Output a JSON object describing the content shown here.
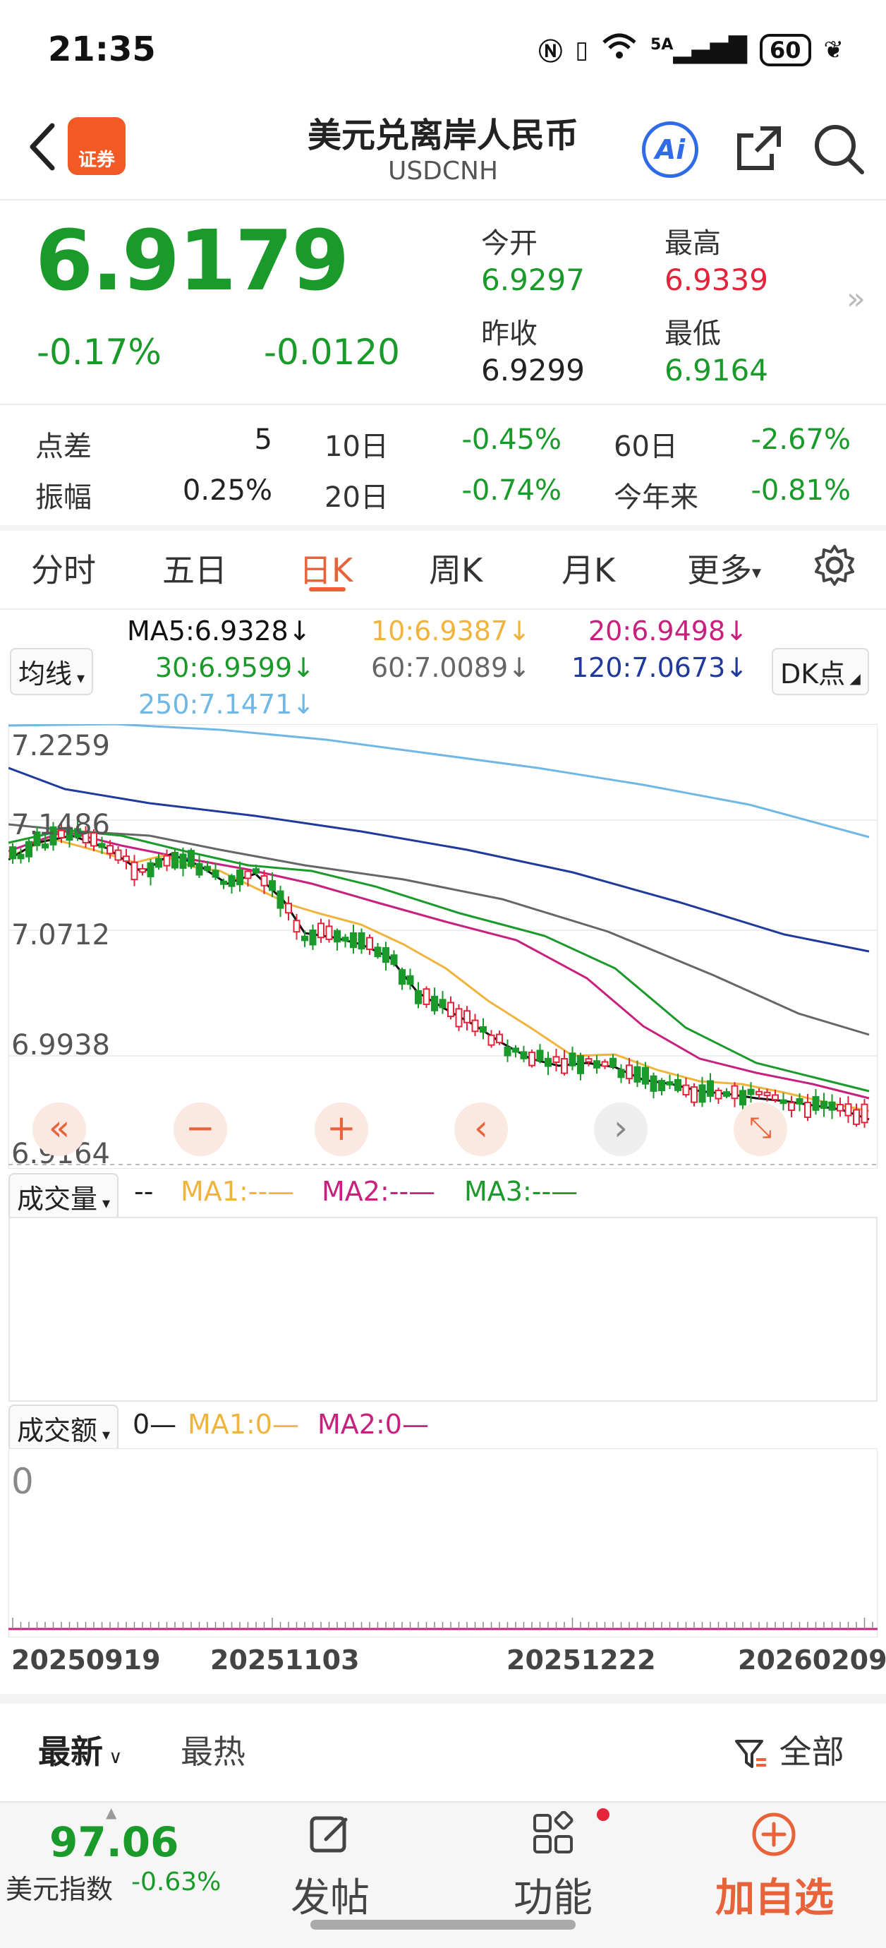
{
  "status_bar": {
    "time": "21:35",
    "signal": "5A",
    "battery": "60"
  },
  "header": {
    "app_logo_text": "证券",
    "title": "美元兑离岸人民币",
    "subtitle": "USDCNH",
    "ai_label": "Ai"
  },
  "quote": {
    "price": "6.9179",
    "change_pct": "-0.17%",
    "change_abs": "-0.0120",
    "open_label": "今开",
    "open": "6.9297",
    "high_label": "最高",
    "high": "6.9339",
    "prev_close_label": "昨收",
    "prev_close": "6.9299",
    "low_label": "最低",
    "low": "6.9164",
    "more_arrow": "»"
  },
  "stats": {
    "spread_label": "点差",
    "spread": "5",
    "d10_label": "10日",
    "d10": "-0.45%",
    "d60_label": "60日",
    "d60": "-2.67%",
    "amplitude_label": "振幅",
    "amplitude": "0.25%",
    "d20_label": "20日",
    "d20": "-0.74%",
    "ytd_label": "今年来",
    "ytd": "-0.81%"
  },
  "tabs": [
    "分时",
    "五日",
    "日K",
    "周K",
    "月K",
    "更多"
  ],
  "ma_legend": {
    "selector": "均线",
    "ma5": "MA5:6.9328↓",
    "ma10": "10:6.9387↓",
    "ma20": "20:6.9498↓",
    "ma30": "30:6.9599↓",
    "ma60": "60:7.0089↓",
    "ma120": "120:7.0673↓",
    "ma250": "250:7.1471↓",
    "dk": "DK点"
  },
  "colors": {
    "up": "#e3243b",
    "down": "#1a9a2a",
    "ma5": "#111111",
    "ma10": "#f0b43c",
    "ma20": "#c8207e",
    "ma30": "#1a9a2a",
    "ma60": "#666666",
    "ma120": "#1f3a9c",
    "ma250": "#6fb8e6",
    "accent": "#e8623a"
  },
  "price_axis": [
    "7.2259",
    "7.1486",
    "7.0712",
    "6.9938",
    "6.9164"
  ],
  "volume": {
    "selector": "成交量",
    "value": "--",
    "ma1": "MA1:--—",
    "ma2": "MA2:--—",
    "ma3": "MA3:--—"
  },
  "turnover": {
    "selector": "成交额",
    "value": "0—",
    "ma1": "MA1:0—",
    "ma2": "MA2:0—",
    "zero": "0"
  },
  "dates": [
    "20250919",
    "20251103",
    "20251222",
    "20260209"
  ],
  "feed": {
    "latest": "最新",
    "hot": "最热",
    "filter": "全部"
  },
  "bottom_bar": {
    "index_value": "97.06",
    "index_name": "美元指数",
    "index_change": "-0.63%",
    "post": "发帖",
    "functions": "功能",
    "add_watch": "加自选"
  }
}
